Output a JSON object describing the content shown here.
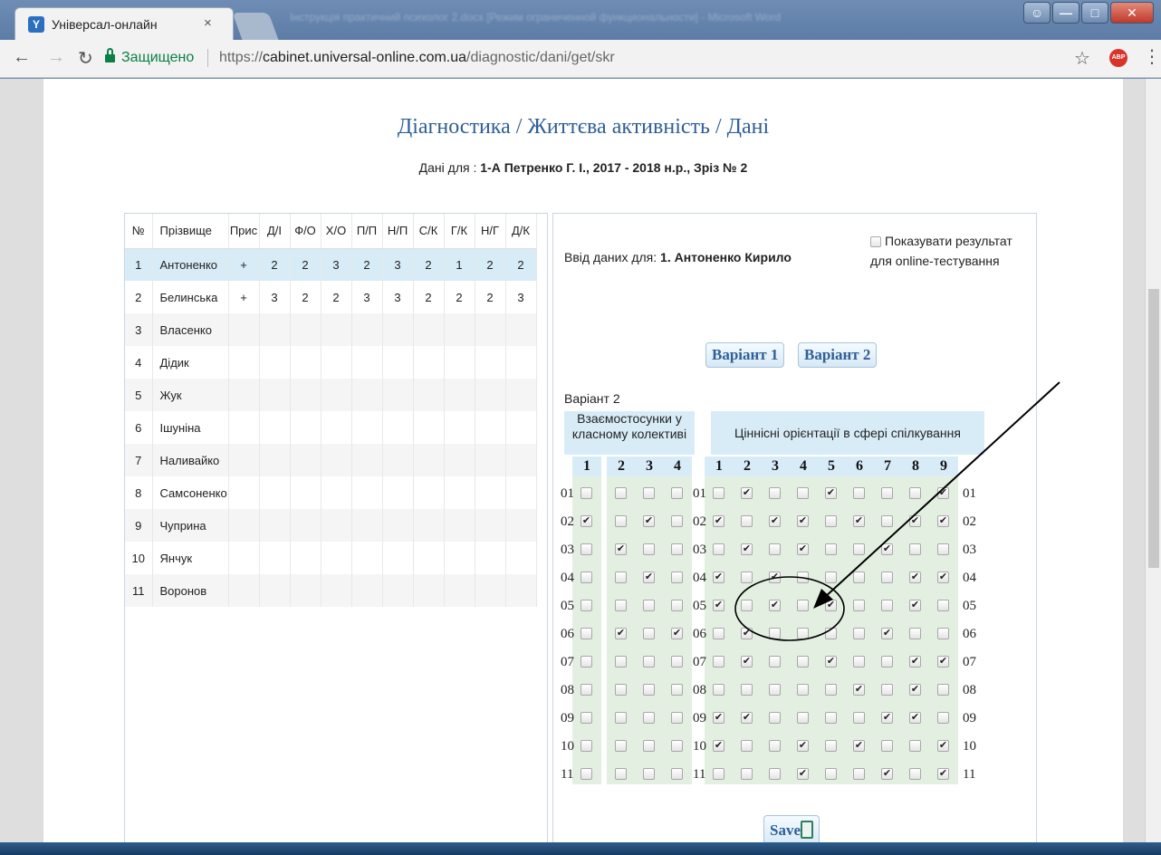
{
  "browser": {
    "tab_title": "Універсал-онлайн",
    "tab_close": "×",
    "secure_label": "Защищено",
    "url_scheme": "https://",
    "url_host": "cabinet.universal-online.com.ua",
    "url_path": "/diagnostic/dani/get/skr",
    "window_title": "Інструкція практичний психолог 2.docx [Режим ограниченной функциональности] - Microsoft Word"
  },
  "page": {
    "title": "Діагностика / Життєва активність / Дані",
    "subtitle_prefix": "Дані для : ",
    "subtitle_value": "1-А Петренко Г. І., 2017 - 2018 н.р., Зріз № 2"
  },
  "table": {
    "headers": [
      "№",
      "Прізвище",
      "Прис",
      "Д/І",
      "Ф/О",
      "Х/О",
      "П/П",
      "Н/П",
      "С/К",
      "Г/К",
      "Н/Г",
      "Д/К"
    ],
    "rows": [
      [
        "1",
        "Антоненко",
        "+",
        "2",
        "2",
        "3",
        "2",
        "3",
        "2",
        "1",
        "2",
        "2"
      ],
      [
        "2",
        "Белинська",
        "+",
        "3",
        "2",
        "2",
        "3",
        "3",
        "2",
        "2",
        "2",
        "3"
      ],
      [
        "3",
        "Власенко",
        "",
        "",
        "",
        "",
        "",
        "",
        "",
        "",
        "",
        ""
      ],
      [
        "4",
        "Дідик",
        "",
        "",
        "",
        "",
        "",
        "",
        "",
        "",
        "",
        ""
      ],
      [
        "5",
        "Жук",
        "",
        "",
        "",
        "",
        "",
        "",
        "",
        "",
        "",
        ""
      ],
      [
        "6",
        "Ішуніна",
        "",
        "",
        "",
        "",
        "",
        "",
        "",
        "",
        "",
        ""
      ],
      [
        "7",
        "Наливайко",
        "",
        "",
        "",
        "",
        "",
        "",
        "",
        "",
        "",
        ""
      ],
      [
        "8",
        "Самсоненко",
        "",
        "",
        "",
        "",
        "",
        "",
        "",
        "",
        "",
        ""
      ],
      [
        "9",
        "Чуприна",
        "",
        "",
        "",
        "",
        "",
        "",
        "",
        "",
        "",
        ""
      ],
      [
        "10",
        "Янчук",
        "",
        "",
        "",
        "",
        "",
        "",
        "",
        "",
        "",
        ""
      ],
      [
        "11",
        "Воронов",
        "",
        "",
        "",
        "",
        "",
        "",
        "",
        "",
        "",
        ""
      ]
    ]
  },
  "entry": {
    "prefix": "Ввід даних для: ",
    "student": "1. Антоненко Кирило",
    "show_result_line1": "Показувати результат",
    "show_result_line2": "для online-тестування",
    "variant1": "Варіант 1",
    "variant2": "Варіант 2",
    "variant_label": "Варіант 2",
    "group1_title": "Взаємостосунки у класному колективі",
    "group2_title": "Ціннісні орієнтації в сфері спілкування",
    "save": "Save"
  },
  "grid": {
    "row_labels": [
      "01",
      "02",
      "03",
      "04",
      "05",
      "06",
      "07",
      "08",
      "09",
      "10",
      "11"
    ],
    "group1_cols": [
      "1",
      "2",
      "3",
      "4"
    ],
    "group2_cols": [
      "1",
      "2",
      "3",
      "4",
      "5",
      "6",
      "7",
      "8",
      "9"
    ],
    "group1_checked": [
      [
        0,
        0,
        0,
        0
      ],
      [
        1,
        0,
        1,
        0
      ],
      [
        0,
        1,
        0,
        0
      ],
      [
        0,
        0,
        1,
        0
      ],
      [
        0,
        0,
        0,
        0
      ],
      [
        0,
        1,
        0,
        1
      ],
      [
        0,
        0,
        0,
        0
      ],
      [
        0,
        0,
        0,
        0
      ],
      [
        0,
        0,
        0,
        0
      ],
      [
        0,
        0,
        0,
        0
      ],
      [
        0,
        0,
        0,
        0
      ]
    ],
    "group2_checked": [
      [
        0,
        1,
        0,
        0,
        1,
        0,
        0,
        0,
        1
      ],
      [
        1,
        0,
        1,
        1,
        0,
        1,
        0,
        1,
        1
      ],
      [
        0,
        1,
        0,
        1,
        0,
        0,
        1,
        0,
        0
      ],
      [
        1,
        0,
        1,
        0,
        0,
        0,
        0,
        1,
        1
      ],
      [
        1,
        0,
        1,
        0,
        1,
        0,
        0,
        1,
        0
      ],
      [
        0,
        1,
        0,
        0,
        0,
        0,
        1,
        0,
        0
      ],
      [
        0,
        1,
        0,
        0,
        1,
        0,
        0,
        1,
        1
      ],
      [
        0,
        0,
        0,
        0,
        0,
        1,
        0,
        1,
        0
      ],
      [
        1,
        1,
        0,
        0,
        0,
        0,
        1,
        1,
        0
      ],
      [
        1,
        0,
        0,
        1,
        0,
        1,
        0,
        0,
        1
      ],
      [
        0,
        0,
        0,
        1,
        0,
        0,
        1,
        0,
        1
      ]
    ]
  },
  "colors": {
    "accent": "#2f5f96",
    "header_bg": "#d8ecf7",
    "column_band": "#e3efe1",
    "secure": "#0b8043"
  }
}
